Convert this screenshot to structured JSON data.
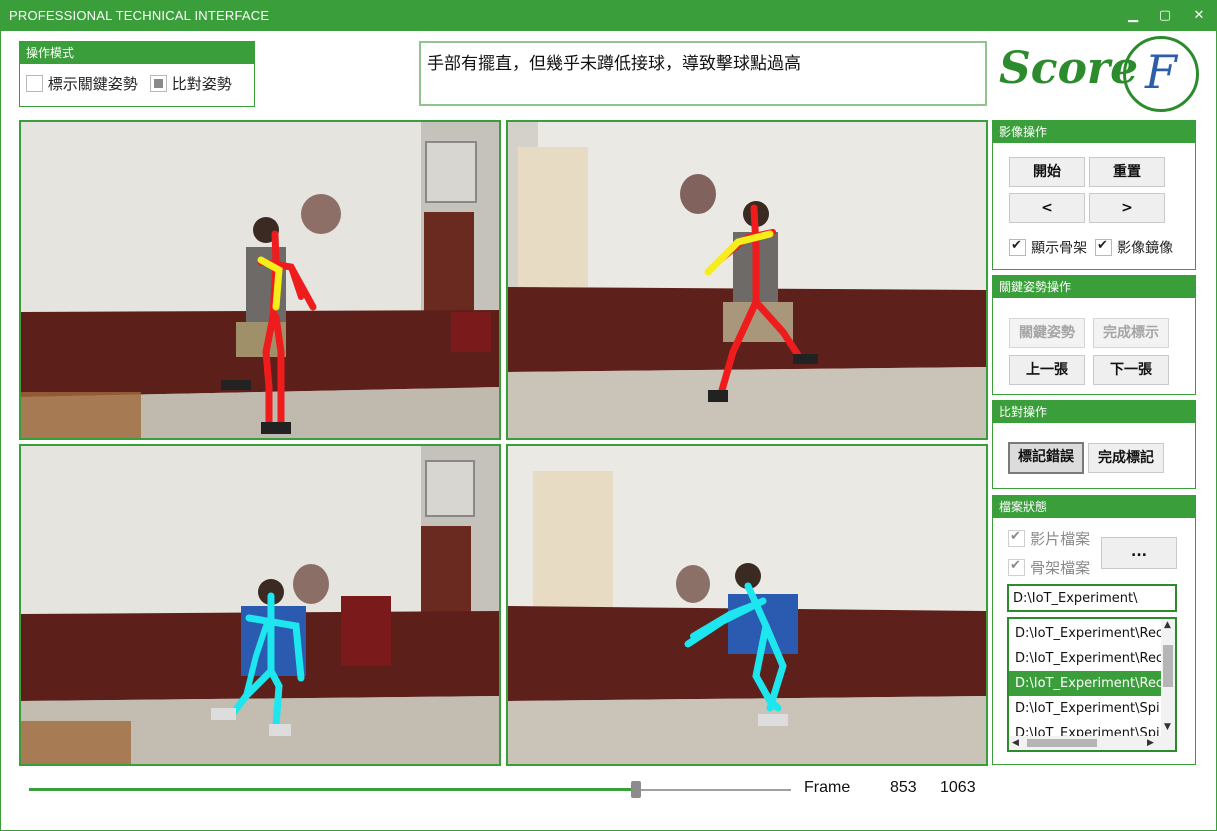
{
  "window": {
    "title": "PROFESSIONAL TECHNICAL INTERFACE"
  },
  "operation_mode": {
    "header": "操作模式",
    "options": [
      {
        "label": "標示關鍵姿勢",
        "state": "unchecked"
      },
      {
        "label": "比對姿勢",
        "state": "indeterminate"
      }
    ]
  },
  "feedback_message": "手部有擺直，但幾乎未蹲低接球，導致擊球點過高",
  "logo": {
    "word": "Score",
    "letter": "F"
  },
  "colors": {
    "accent": "#3a9e3a",
    "skeleton_red": "#ee1c1c",
    "skeleton_yellow": "#f5ee1a",
    "skeleton_cyan": "#1ee6ee"
  },
  "video_panel": {
    "header": "影像操作",
    "start_label": "開始",
    "reset_label": "重置",
    "prev_label": "<",
    "next_label": ">",
    "show_skeleton_label": "顯示骨架",
    "mirror_label": "影像鏡像"
  },
  "keypose_panel": {
    "header": "關鍵姿勢操作",
    "keypose_label": "關鍵姿勢",
    "finish_mark_label": "完成標示",
    "prev_label": "上一張",
    "next_label": "下一張"
  },
  "compare_panel": {
    "header": "比對操作",
    "mark_error_label": "標記錯誤",
    "finish_label": "完成標記"
  },
  "file_panel": {
    "header": "檔案狀態",
    "video_file_label": "影片檔案",
    "skeleton_file_label": "骨架檔案",
    "browse_label": "...",
    "path_value": "D:\\IoT_Experiment\\",
    "files": [
      "D:\\IoT_Experiment\\Rec",
      "D:\\IoT_Experiment\\Rec",
      "D:\\IoT_Experiment\\Rec",
      "D:\\IoT_Experiment\\Spi",
      "D:\\IoT_Experiment\\Spi"
    ],
    "selected_index": 2
  },
  "timeline": {
    "frame_label": "Frame",
    "current_frame": "853",
    "total_frames": "1063",
    "progress": 0.8025
  }
}
